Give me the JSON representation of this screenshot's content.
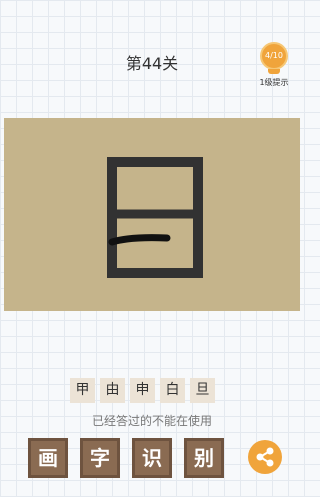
{
  "level": {
    "title": "第44关"
  },
  "hint": {
    "counter": "4/10",
    "label": "1级提示"
  },
  "options": [
    "甲",
    "由",
    "申",
    "白",
    "旦"
  ],
  "notice": "已经答过的不能在使用",
  "answer": [
    "画",
    "字",
    "识",
    "别"
  ],
  "colors": {
    "canvas": "#c5b48b",
    "tile": "#8a6b52",
    "accent": "#f0a43b",
    "option_bg": "#ece3d6"
  },
  "icons": {
    "hint": "lightbulb-icon",
    "share": "share-icon"
  }
}
